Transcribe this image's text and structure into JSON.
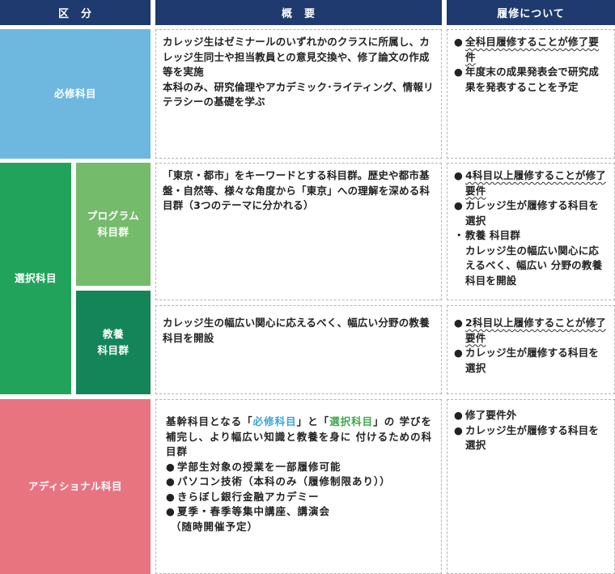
{
  "header": {
    "col1": "区　分",
    "col2": "概　要",
    "col3": "履修について"
  },
  "colors": {
    "header_bg": "#1e3a6e",
    "required": "#6eb8e0",
    "elective": "#22a35b",
    "program": "#74bb6c",
    "kyoyo": "#148558",
    "additional": "#e87480",
    "accent_blue": "#3aa3d4",
    "accent_green": "#3fa64a"
  },
  "rows": {
    "required": {
      "label": "必修科目",
      "summary": [
        "カレッジ生はゼミナールのいずれかのクラスに所属し、カレッジ生同士や担当教員との意見交換や、修了論文の作成等を実施",
        "本科のみ、研究倫理やアカデミック･ライティング、情報リテラシーの基礎を学ぶ"
      ],
      "req_marks": [
        "●",
        "●"
      ],
      "req_underlined": "全科目履修することが修了要件",
      "req_text": "年度末の成果発表会で研究成果を発表することを予定"
    },
    "elective": {
      "label": "選択科目",
      "program": {
        "label_line1": "プログラム",
        "label_line2": "科目群",
        "summary": "「東京・都市」をキーワードとする科目群。歴史や都市基盤・自然等、様々な角度から「東京」への理解を深める科目群（3つのテーマに分かれる）",
        "req_marks": [
          "●",
          "●",
          "・"
        ],
        "req_underlined": "4科目以上履修することが修了要件",
        "req_line2": "カレッジ生が履修する科目を選択",
        "req_line3_head": "教養 科目群",
        "req_line3_body": "カレッジ生の幅広い関心に応えるべく、幅広い 分野の教養科目を開設"
      },
      "kyoyo": {
        "label_line1": "教養",
        "label_line2": "科目群",
        "summary": "カレッジ生の幅広い関心に応えるべく、幅広い分野の教養科目を開設",
        "req_marks": [
          "●",
          "●"
        ],
        "req_underlined": "2科目以上履修することが修了要件",
        "req_line2": "カレッジ生が履修する科目を選択"
      }
    },
    "additional": {
      "label": "アディショナル科目",
      "summary_pre": "基幹科目となる「",
      "summary_blue": "必修科目",
      "summary_mid": "」と「",
      "summary_green": "選択科目",
      "summary_post": "」の 学びを補完し、より幅広い知識と教養を身に 付けるための科目群",
      "bullet_marks": [
        "●",
        "●",
        "●",
        "●"
      ],
      "bullets": [
        "学部生対象の授業を一部履修可能",
        "パソコン技術（本科のみ（履修制限あり））",
        "きらぼし銀行金融アカデミー",
        "夏季・春季等集中講座、講演会"
      ],
      "bullet_note": "（随時開催予定）",
      "req_marks": [
        "●",
        "●"
      ],
      "req_line1": "修了要件外",
      "req_line2": "カレッジ生が履修する科目を選択"
    }
  }
}
